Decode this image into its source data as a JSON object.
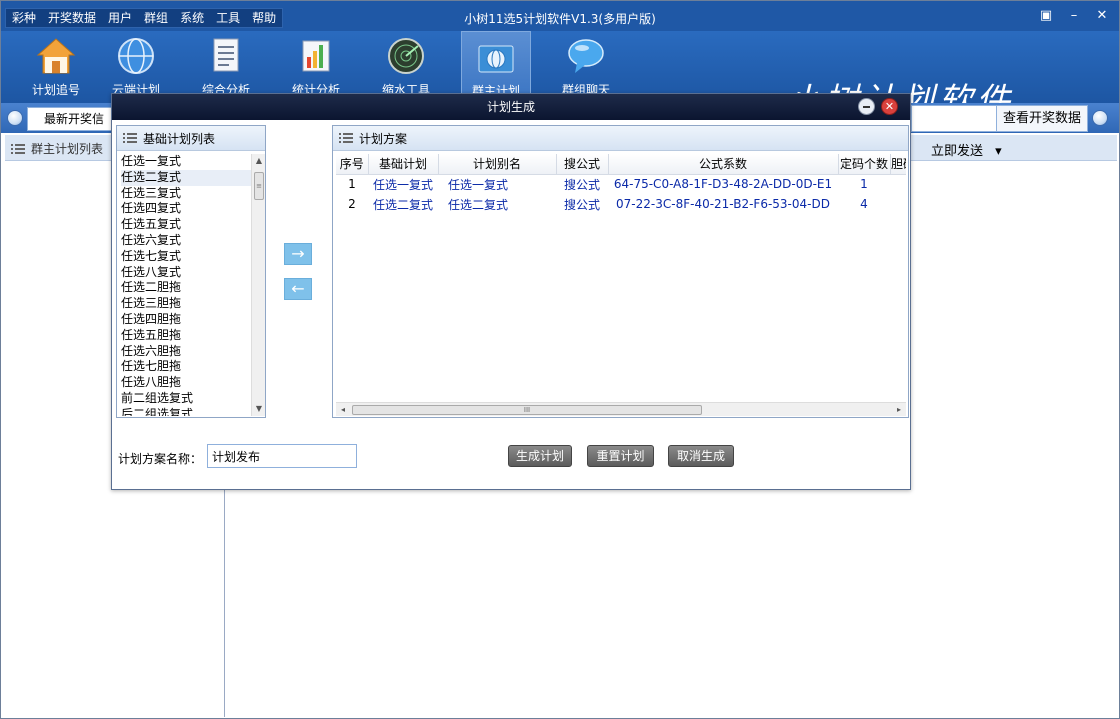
{
  "window": {
    "title": "小树11选5计划软件V1.3(多用户版)",
    "menu": [
      "彩种",
      "开奖数据",
      "用户",
      "群组",
      "系统",
      "工具",
      "帮助"
    ],
    "controls": {
      "feedback": "▣",
      "minimize": "–",
      "close": "✕"
    }
  },
  "toolbar": {
    "items": [
      {
        "label": "计划追号",
        "icon": "house-icon"
      },
      {
        "label": "云端计划",
        "icon": "globe-icon"
      },
      {
        "label": "综合分析",
        "icon": "document-icon"
      },
      {
        "label": "统计分析",
        "icon": "bar-chart-icon"
      },
      {
        "label": "缩水工具",
        "icon": "radar-icon"
      },
      {
        "label": "群主计划",
        "icon": "folder-globe-icon"
      },
      {
        "label": "群组聊天",
        "icon": "chat-bubble-icon"
      }
    ],
    "logo_text": "小树计划软件"
  },
  "subbar": {
    "latest_label": "最新开奖信",
    "view_button": "查看开奖数据"
  },
  "rowbar": {
    "left_title": "群主计划列表",
    "send_label": "立即发送",
    "send_arrow": "▾"
  },
  "dialog": {
    "title": "计划生成",
    "close_glyph": "✕",
    "left_panel": {
      "title": "基础计划列表",
      "items": [
        "任选一复式",
        "任选二复式",
        "任选三复式",
        "任选四复式",
        "任选五复式",
        "任选六复式",
        "任选七复式",
        "任选八复式",
        "任选二胆拖",
        "任选三胆拖",
        "任选四胆拖",
        "任选五胆拖",
        "任选六胆拖",
        "任选七胆拖",
        "任选八胆拖",
        "前二组选复式",
        "后二组选复式"
      ],
      "selected_index": 1
    },
    "arrows": {
      "add": "→",
      "remove": "←"
    },
    "right_panel": {
      "title": "计划方案",
      "columns": [
        "序号",
        "基础计划",
        "计划别名",
        "搜公式",
        "公式系数",
        "定码个数",
        "胆码"
      ],
      "rows": [
        {
          "no": "1",
          "base": "任选一复式",
          "alias": "任选一复式",
          "search": "搜公式",
          "coef": "64-75-C0-A8-1F-D3-48-2A-DD-0D-E1",
          "count": "1"
        },
        {
          "no": "2",
          "base": "任选二复式",
          "alias": "任选二复式",
          "search": "搜公式",
          "coef": "07-22-3C-8F-40-21-B2-F6-53-04-DD",
          "count": "4"
        }
      ]
    },
    "scroll": {
      "up": "▲",
      "down": "▼",
      "left": "◂",
      "right": "▸",
      "grip": "≡",
      "hgrip": "III"
    },
    "name_label": "计划方案名称：",
    "name_value": "计划发布",
    "buttons": {
      "generate": "生成计划",
      "reset": "重置计划",
      "cancel": "取消生成"
    }
  }
}
